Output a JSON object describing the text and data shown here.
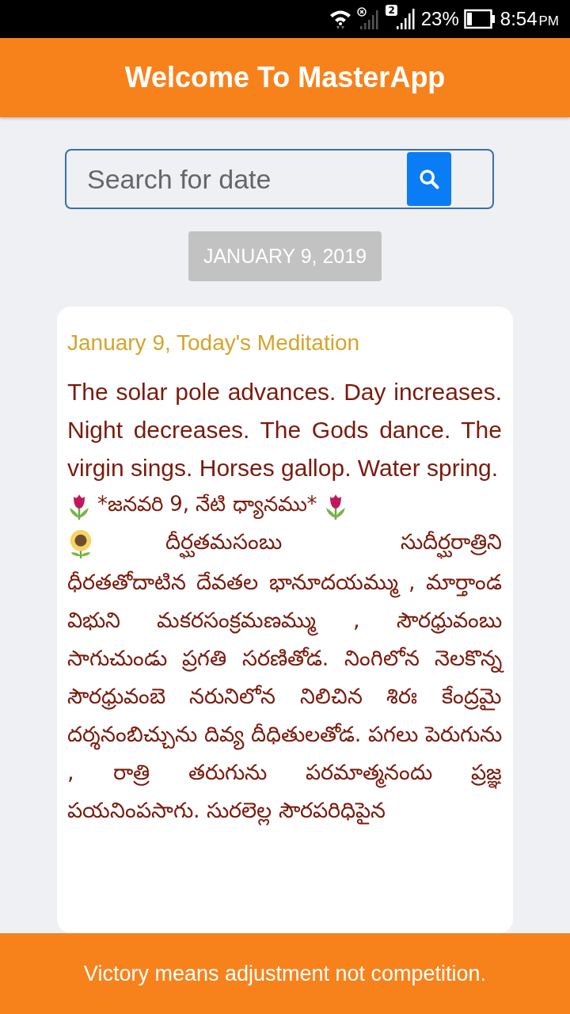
{
  "status_bar": {
    "sim_badge": "2",
    "battery": "23%",
    "time": "8:54",
    "meridiem": "PM"
  },
  "header": {
    "title": "Welcome To MasterApp"
  },
  "search": {
    "placeholder": "Search for date"
  },
  "date_chip": "JANUARY 9, 2019",
  "card": {
    "title": "January 9, Today's Meditation",
    "english": "The solar pole advances. Day increases. Night decreases. The Gods dance. The virgin sings. Horses gallop. Water spring.",
    "telugu_heading": "*జనవరి 9, నేటి ధ్యానము*",
    "telugu_first_line": "దీర్ఘతమసంబు సుదీర్ఘరాత్రిని",
    "telugu_body": "ధీరతతోదాటిన దేవతల భానూదయమ్ము , మార్తాండ విభుని మకరసంక్రమణమ్ము , సౌరధ్రువంబు సాగుచుండు ప్రగతి సరణితోడ. నింగిలోన నెలకొన్న సౌరధ్రువంబె నరునిలోన నిలిచిన శిరః కేంద్రమై దర్శనంబిచ్చును దివ్య దీధితులతోడ. పగలు పెరుగును , రాత్రి తరుగును పరమాత్మనందు ప్రజ్ఞ పయనింపసాగు. సురలెల్ల సౌరపరిధిపైన"
  },
  "footer": {
    "quote": "Victory means adjustment not competition."
  }
}
